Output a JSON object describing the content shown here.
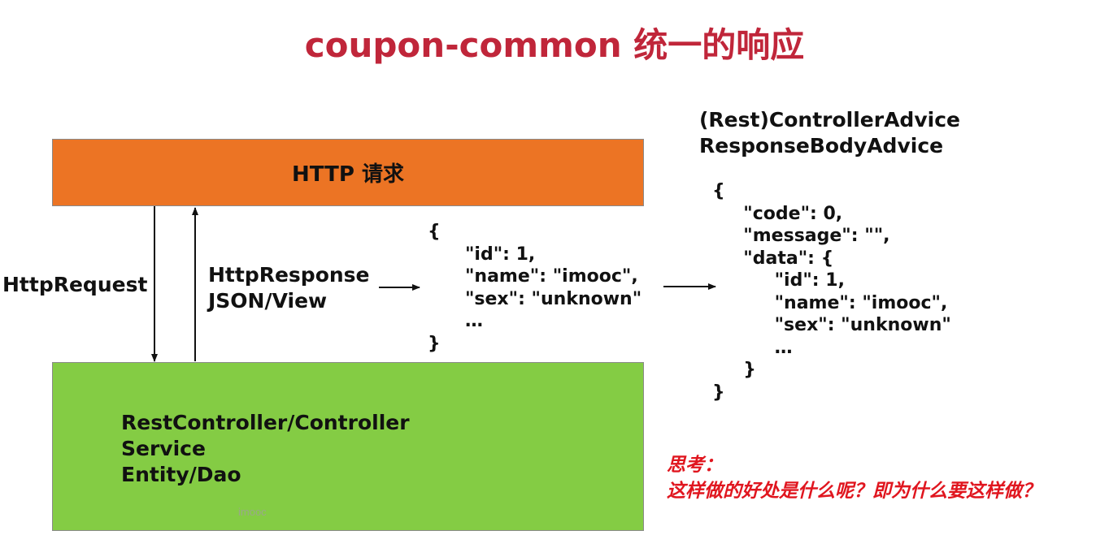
{
  "title": "coupon-common 统一的响应",
  "http_box": {
    "label": "HTTP 请求"
  },
  "request_label": "HttpRequest",
  "response_labels": [
    "HttpResponse",
    "JSON/View"
  ],
  "stack": {
    "lines": [
      "RestController/Controller",
      "Service",
      "Entity/Dao"
    ],
    "watermark": "imooc"
  },
  "raw_json": {
    "lines": [
      "{",
      "      \"id\": 1,",
      "      \"name\": \"imooc\",",
      "      \"sex\": \"unknown\"",
      "      …",
      "}"
    ]
  },
  "advice": {
    "lines": [
      "(Rest)ControllerAdvice",
      " ResponseBodyAdvice"
    ]
  },
  "wrapped_json": {
    "lines": [
      "{",
      "     \"code\": 0,",
      "     \"message\": \"\",",
      "     \"data\": {",
      "          \"id\": 1,",
      "          \"name\": \"imooc\",",
      "          \"sex\": \"unknown\"",
      "          …",
      "     }",
      "}"
    ]
  },
  "note": {
    "heading": "思考：",
    "question": "这样做的好处是什么呢？即为什么要这样做？"
  },
  "colors": {
    "title": "#c0263a",
    "http_box": "#ec7424",
    "stack_box": "#84cc44",
    "note": "#e0161f"
  }
}
